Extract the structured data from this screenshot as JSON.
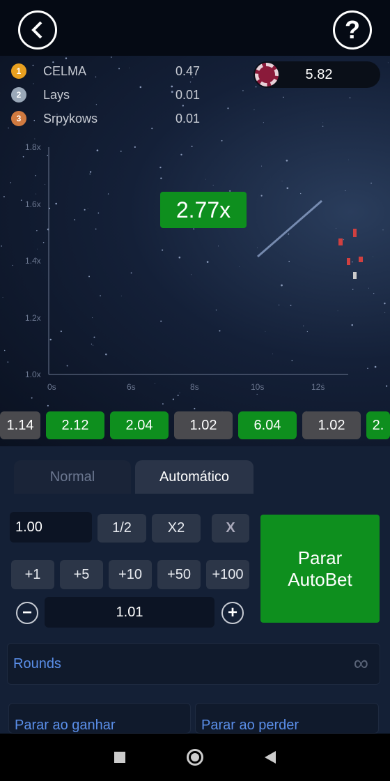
{
  "header": {
    "back_icon": "chevron-left-icon",
    "help_label": "?"
  },
  "leaderboard": [
    {
      "rank": "1",
      "name": "CELMA",
      "value": "0.47",
      "color": "#e8a020"
    },
    {
      "rank": "2",
      "name": "Lays",
      "value": "0.01",
      "color": "#9aa8b8"
    },
    {
      "rank": "3",
      "name": "Srpykows",
      "value": "0.01",
      "color": "#d07a40"
    }
  ],
  "balance": "5.82",
  "chart_data": {
    "type": "line",
    "y_ticks": [
      "1.0x",
      "1.2x",
      "1.4x",
      "1.6x",
      "1.8x"
    ],
    "x_ticks": [
      "0s",
      "6s",
      "8s",
      "10s",
      "12s"
    ],
    "ylim": [
      1.0,
      1.8
    ]
  },
  "multiplier": "2.77x",
  "history": [
    {
      "v": "1.14",
      "win": false
    },
    {
      "v": "2.12",
      "win": true
    },
    {
      "v": "2.04",
      "win": true
    },
    {
      "v": "1.02",
      "win": false
    },
    {
      "v": "6.04",
      "win": true
    },
    {
      "v": "1.02",
      "win": false
    },
    {
      "v": "2.",
      "win": true
    }
  ],
  "tabs": {
    "normal": "Normal",
    "auto": "Automático"
  },
  "bet": {
    "amount": "1.00",
    "half": "1/2",
    "double": "X2",
    "clear": "X",
    "increments": [
      "+1",
      "+5",
      "+10",
      "+50",
      "+100"
    ],
    "cashout": "1.01",
    "minus": "−",
    "plus": "+"
  },
  "action": {
    "line1": "Parar",
    "line2": "AutoBet"
  },
  "rounds": {
    "label": "Rounds",
    "value": "∞"
  },
  "stop_win": "Parar ao ganhar",
  "stop_loss": "Parar ao perder",
  "colors": {
    "green": "#0e8f1e",
    "gray": "#4a4a4e",
    "link": "#5a8ee8"
  }
}
